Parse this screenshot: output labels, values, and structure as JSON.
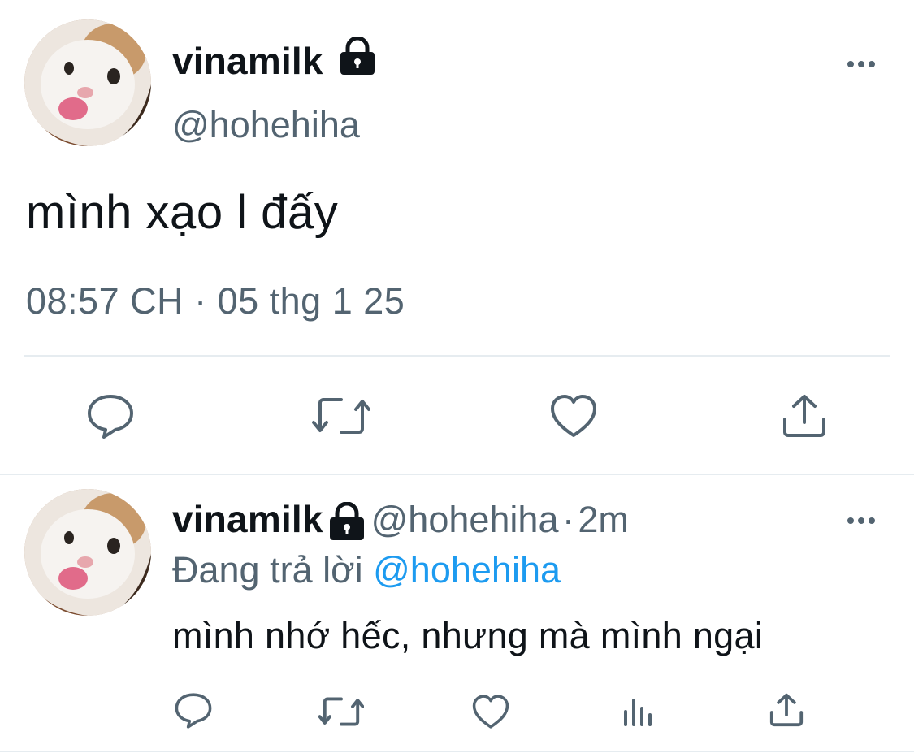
{
  "tweet": {
    "display_name": "vinamilk",
    "handle": "@hohehiha",
    "text": "mình xạo l đấy",
    "timestamp": "08:57 CH · 05 thg 1 25",
    "lock_icon": "lock-icon",
    "more_icon": "more-icon",
    "actions": [
      "reply-icon",
      "retweet-icon",
      "like-icon",
      "share-icon"
    ]
  },
  "reply": {
    "display_name": "vinamilk",
    "handle": "@hohehiha",
    "separator": "·",
    "time": "2m",
    "replying_prefix": "Đang trả lời",
    "replying_to": "@hohehiha",
    "text": "mình nhớ hếc, nhưng mà mình ngại",
    "actions": [
      "reply-icon",
      "retweet-icon",
      "like-icon",
      "analytics-icon",
      "share-icon"
    ]
  },
  "colors": {
    "text": "#0f1419",
    "secondary": "#536471",
    "accent": "#1d9bf0",
    "divider": "#e6ecf0"
  }
}
